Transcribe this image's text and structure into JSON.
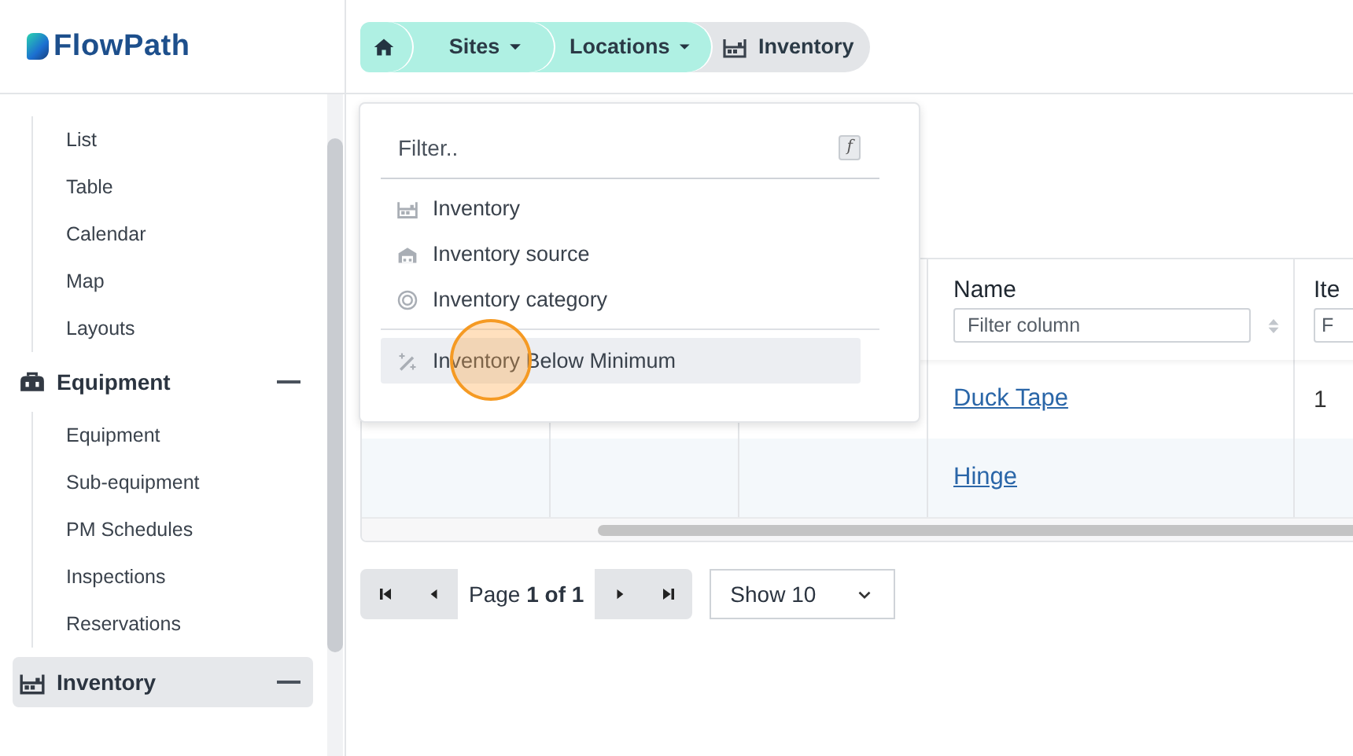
{
  "logo": {
    "text": "FlowPath"
  },
  "breadcrumb": [
    {
      "kind": "home"
    },
    {
      "kind": "dropdown",
      "label": "Sites"
    },
    {
      "kind": "dropdown",
      "label": "Locations"
    },
    {
      "kind": "current",
      "label": "Inventory"
    }
  ],
  "sidebar": {
    "leading_items": [
      {
        "label": "List"
      },
      {
        "label": "Table"
      },
      {
        "label": "Calendar"
      },
      {
        "label": "Map"
      },
      {
        "label": "Layouts"
      }
    ],
    "sections": [
      {
        "label": "Equipment",
        "expanded": true,
        "selected": false,
        "children": [
          {
            "label": "Equipment"
          },
          {
            "label": "Sub-equipment"
          },
          {
            "label": "PM Schedules"
          },
          {
            "label": "Inspections"
          },
          {
            "label": "Reservations"
          }
        ]
      },
      {
        "label": "Inventory",
        "expanded": true,
        "selected": true
      }
    ]
  },
  "menu": {
    "filter_placeholder": "Filter..",
    "shortcut": "f",
    "sections": [
      {
        "items": [
          {
            "label": "Inventory",
            "selected": false
          },
          {
            "label": "Inventory source",
            "selected": false
          },
          {
            "label": "Inventory category",
            "selected": false
          }
        ]
      },
      {
        "items": [
          {
            "label": "Inventory Below Minimum",
            "selected": true
          }
        ]
      }
    ]
  },
  "table": {
    "columns": [
      {
        "label": "Name",
        "placeholder": "Filter column",
        "sortable": true
      },
      {
        "label": "Ite",
        "placeholder": "F",
        "sortable": false
      }
    ],
    "rows": [
      {
        "cells": [
          "Duck Tape",
          "1"
        ]
      },
      {
        "cells": [
          "Hinge"
        ]
      }
    ]
  },
  "pager": {
    "page_label": "Page **1 of 1**",
    "page_size": "Show 10"
  }
}
